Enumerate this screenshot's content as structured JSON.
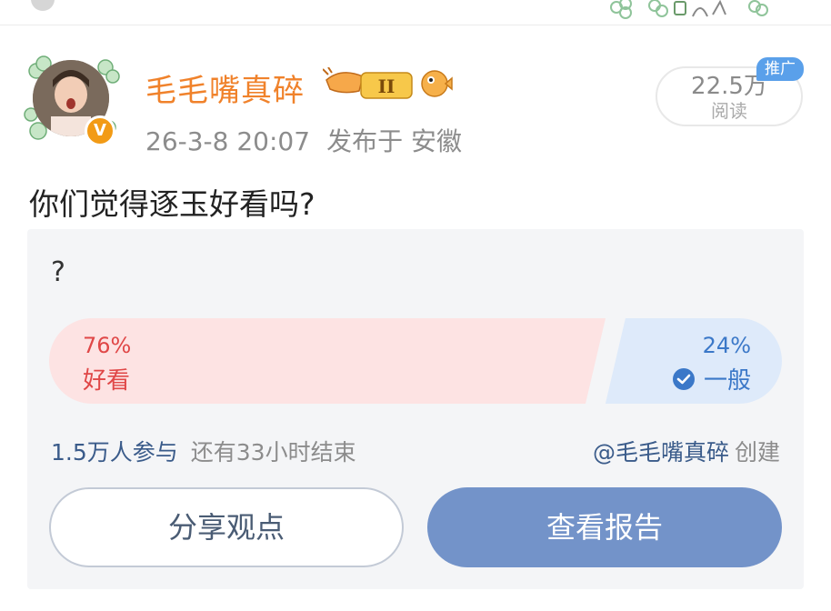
{
  "colors": {
    "username": "#f0822b",
    "accent_blue": "#3b78c8",
    "option_left_bg": "#fde3e3",
    "option_right_bg": "#deeafa",
    "report_button": "#7393c9",
    "promo_tag": "#5aa0ea"
  },
  "post": {
    "author": "毛毛嘴真碎",
    "level_badge": "II",
    "verified_badge": "V",
    "datetime": "26-3-8 20:07",
    "location": "发布于 安徽",
    "reads_count": "22.5万",
    "reads_label": "阅读",
    "promo_tag": "推广",
    "text": "你们觉得逐玉好看吗?"
  },
  "poll": {
    "question": "?",
    "options": [
      {
        "label": "好看",
        "percent": "76%",
        "share": 0.76,
        "selected": false
      },
      {
        "label": "一般",
        "percent": "24%",
        "share": 0.24,
        "selected": true
      }
    ],
    "participants": "1.5万人参与",
    "time_remaining": "还有33小时结束",
    "creator": "@毛毛嘴真碎",
    "creator_suffix": "创建",
    "share_button": "分享观点",
    "report_button": "查看报告"
  },
  "icons": {
    "avatar": "user-avatar",
    "verified": "verified-v-icon",
    "level": "shrimp-level-icon",
    "fish": "pufferfish-icon",
    "check": "check-circle-icon",
    "decor": "clover-decor"
  }
}
